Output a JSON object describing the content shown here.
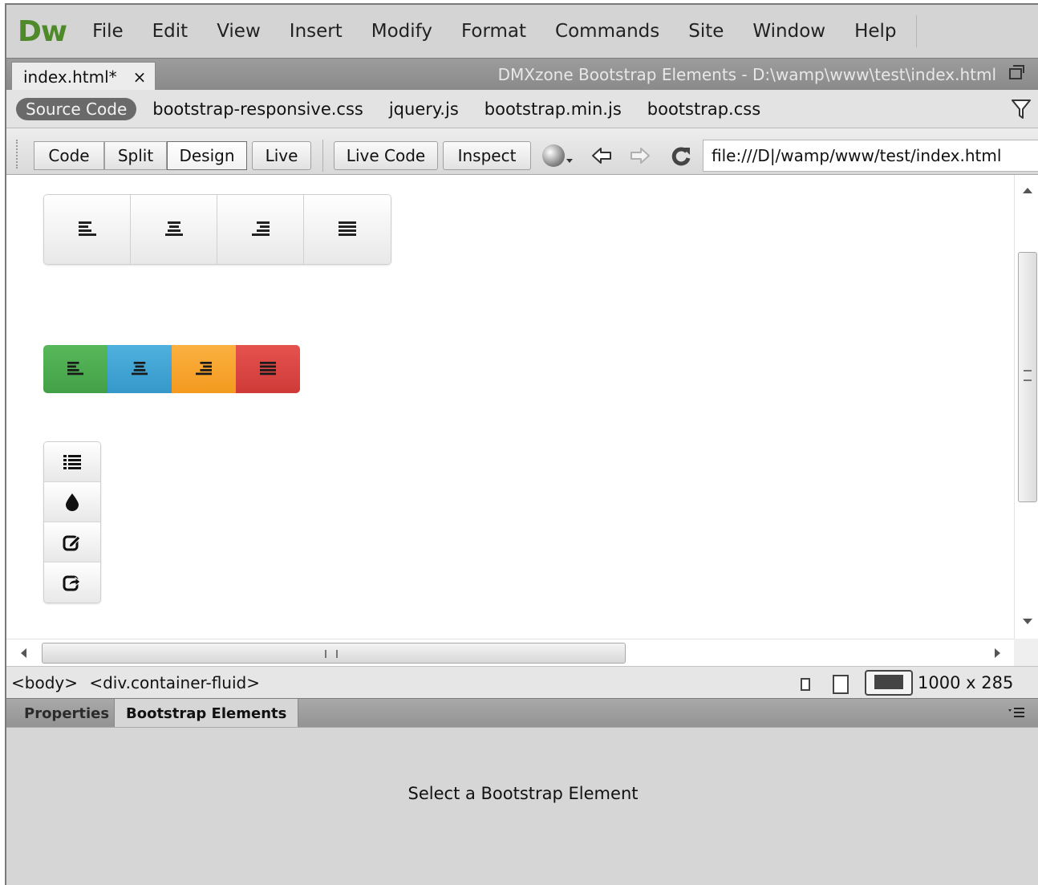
{
  "app": {
    "logo": "Dw",
    "logo_color": "#4f8a2a"
  },
  "menu": [
    "File",
    "Edit",
    "View",
    "Insert",
    "Modify",
    "Format",
    "Commands",
    "Site",
    "Window",
    "Help"
  ],
  "document": {
    "tab_label": "index.html*",
    "tab_close": "×",
    "window_title": "DMXzone Bootstrap Elements - D:\\wamp\\www\\test\\index.html"
  },
  "related_files": {
    "source_label": "Source Code",
    "files": [
      "bootstrap-responsive.css",
      "jquery.js",
      "bootstrap.min.js",
      "bootstrap.css"
    ]
  },
  "toolbar": {
    "code_label": "Code",
    "split_label": "Split",
    "design_label": "Design",
    "live_label": "Live",
    "live_code_label": "Live Code",
    "inspect_label": "Inspect",
    "url": "file:///D|/wamp/www/test/index.html"
  },
  "canvas": {
    "group1_icons": [
      "align-left-icon",
      "align-center-icon",
      "align-right-icon",
      "align-justify-icon"
    ],
    "group2": [
      {
        "icon": "align-left-icon",
        "color": "#4caf50"
      },
      {
        "icon": "align-center-icon",
        "color": "#3ea3d1"
      },
      {
        "icon": "align-right-icon",
        "color": "#f5a030"
      },
      {
        "icon": "align-justify-icon",
        "color": "#d9413f"
      }
    ],
    "group3_icons": [
      "list-icon",
      "tint-icon",
      "edit-icon",
      "share-icon"
    ]
  },
  "statusbar": {
    "tag_body": "<body>",
    "tag_div": "<div.container-fluid>",
    "window_size": "1000 x 285"
  },
  "panel": {
    "tab_properties": "Properties",
    "tab_bootstrap": "Bootstrap Elements",
    "message": "Select a Bootstrap Element"
  }
}
